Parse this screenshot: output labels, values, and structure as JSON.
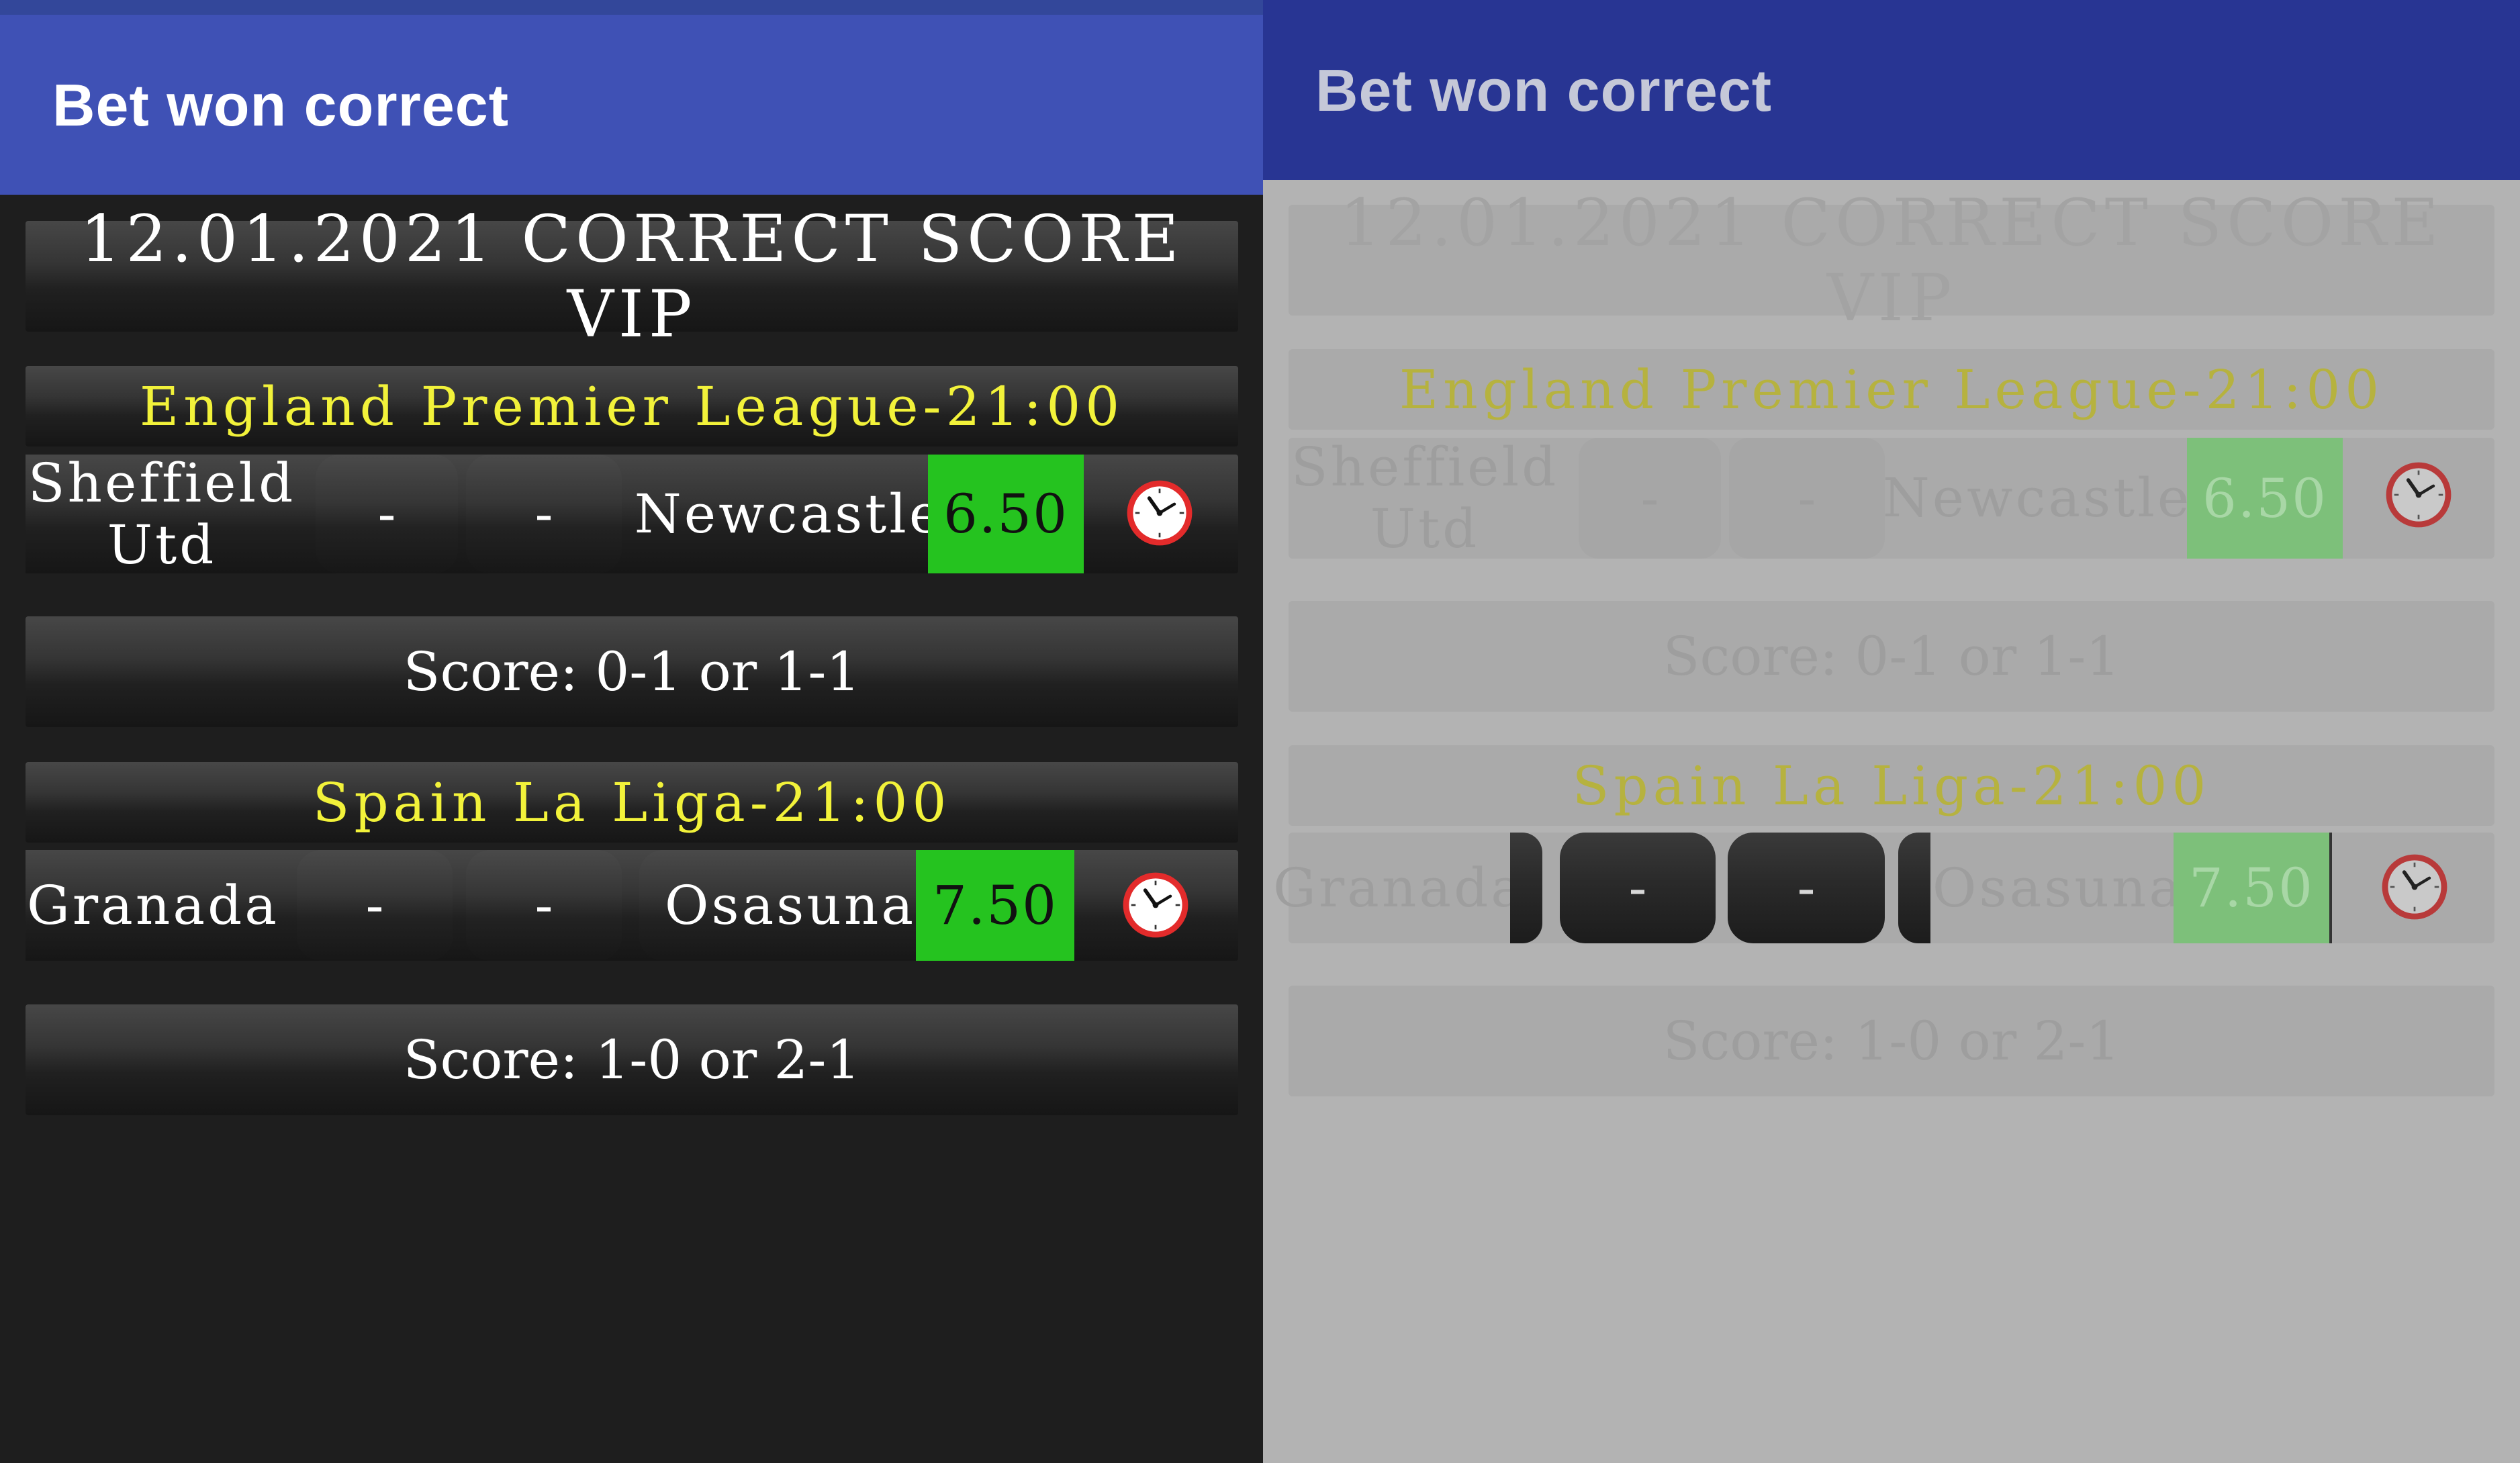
{
  "app": {
    "title": "Bet won correct"
  },
  "header": {
    "title": "12.01.2021 CORRECT SCORE VIP"
  },
  "matches": [
    {
      "league": "England Premier League-21:00",
      "home": "Sheffield Utd",
      "home_line1": "Sheffield",
      "home_line2": "Utd",
      "home_score": "-",
      "away_score": "-",
      "away": "Newcastle",
      "odds": "6.50",
      "prediction": "Score: 0-1 or 1-1"
    },
    {
      "league": "Spain La Liga-21:00",
      "home": "Granada",
      "home_score": "-",
      "away_score": "-",
      "away": "Osasuna",
      "odds": "7.50",
      "prediction": "Score: 1-0 or 2-1"
    }
  ],
  "colors": {
    "app_bar": "#3f51b5",
    "app_bar_dimmed": "#283593",
    "league_text": "#f2f23a",
    "odds_bg": "#25c31f",
    "background": "#1e1e1e",
    "overlay": "#b3b3b3"
  },
  "icons": {
    "kickoff": "alarm-clock-icon"
  }
}
